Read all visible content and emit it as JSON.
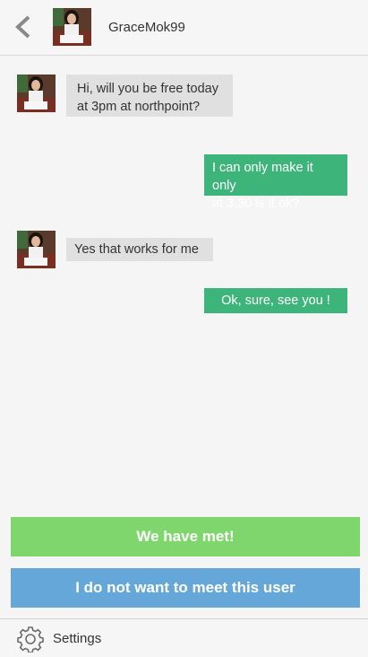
{
  "header": {
    "back_icon": "chevron-left-icon",
    "username": "GraceMok99"
  },
  "messages": [
    {
      "from": "them",
      "text_line1": "Hi, will you be free today",
      "text_line2": "at 3pm at northpoint?"
    },
    {
      "from": "me",
      "text_line1": "I can only make it only",
      "text_line2": "at 3.30 is it ok?"
    },
    {
      "from": "them",
      "text": "Yes that works for me"
    },
    {
      "from": "me",
      "text": "Ok, sure, see you !"
    }
  ],
  "actions": {
    "met_label": "We have met!",
    "decline_label": "I do not want to meet this user"
  },
  "footer": {
    "settings_icon": "gear-icon",
    "settings_label": "Settings"
  },
  "colors": {
    "outgoing_bubble": "#3db47a",
    "incoming_bubble": "#e0e0e0",
    "met_button": "#7ed66c",
    "decline_button": "#65a7d8"
  }
}
